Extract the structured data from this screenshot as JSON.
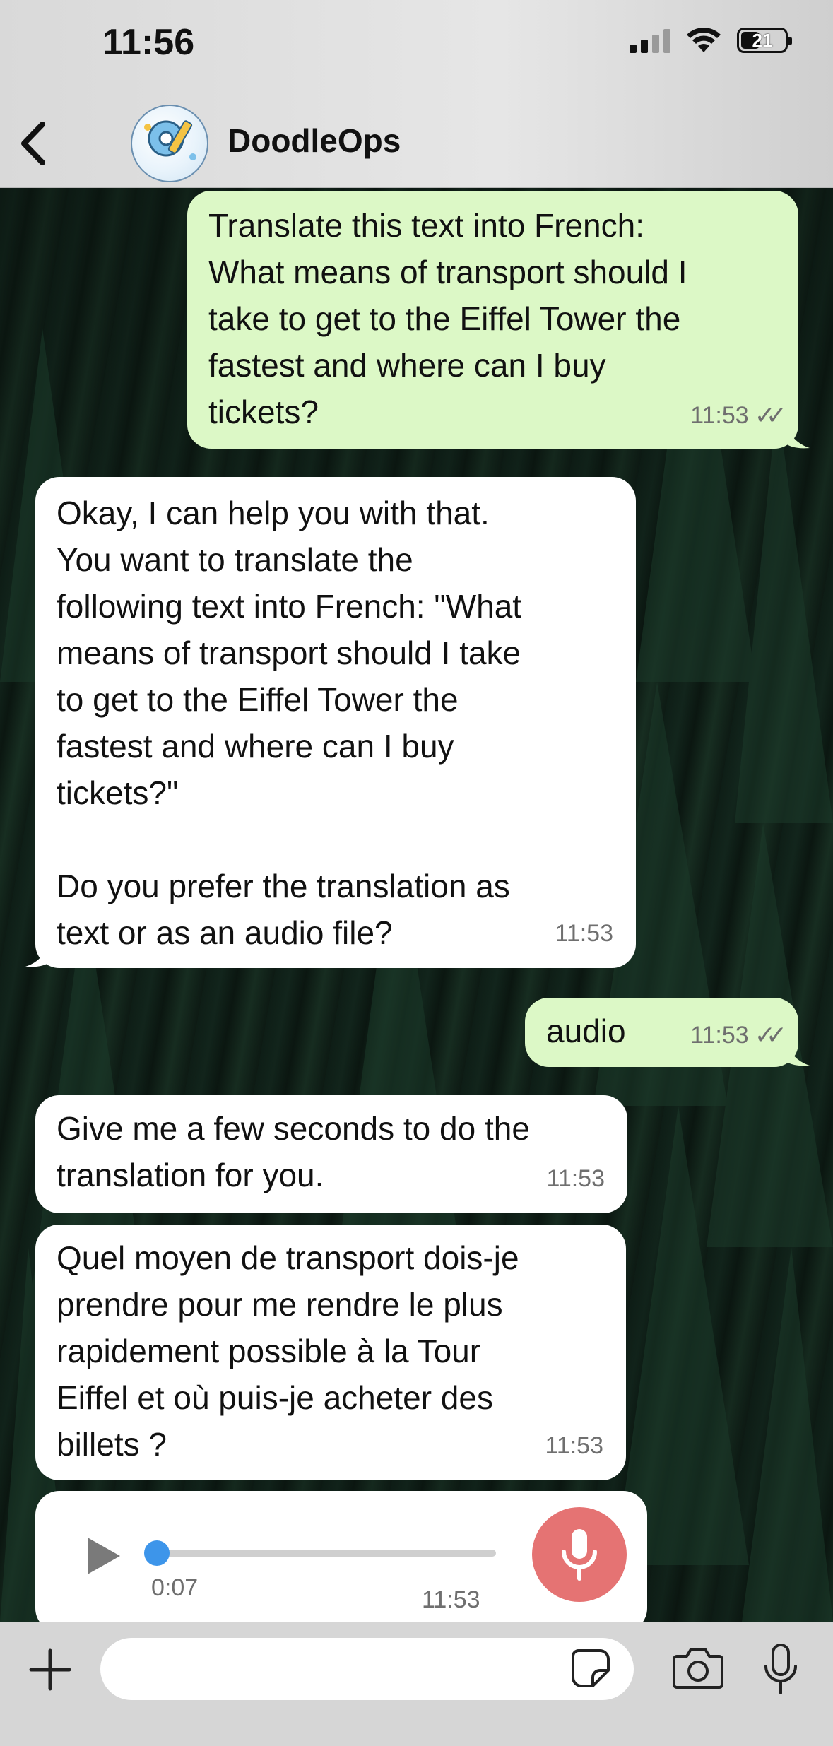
{
  "status_bar": {
    "time": "11:56",
    "battery": "21"
  },
  "header": {
    "contact_name": "DoodleOps",
    "avatar_caption": "DoodleOps"
  },
  "messages": [
    {
      "direction": "out",
      "text": "Translate this text into French:\nWhat means of transport should I\ntake to get to the Eiffel Tower the\nfastest and where can I buy\ntickets?",
      "time": "11:53",
      "status": "read"
    },
    {
      "direction": "in",
      "text": "Okay, I can help you with that.\nYou want to translate the\nfollowing text into French: \"What\nmeans of transport should I take\nto get to the Eiffel Tower the\nfastest and where can I buy\ntickets?\"\n\nDo you prefer the translation as\ntext or as an audio file?",
      "time": "11:53"
    },
    {
      "direction": "out",
      "text": "audio",
      "time": "11:53",
      "status": "read"
    },
    {
      "direction": "in",
      "text": "Give me a few seconds to do the\ntranslation for you.",
      "time": "11:53"
    },
    {
      "direction": "in",
      "text": "Quel moyen de transport dois-je\nprendre pour me rendre le plus\nrapidement possible à la Tour\nEiffel et où puis-je acheter des\nbillets ?",
      "time": "11:53"
    }
  ],
  "voice_message": {
    "duration": "0:07",
    "time": "11:53",
    "progress": 0
  },
  "composer": {
    "placeholder": ""
  },
  "colors": {
    "outgoing_bubble": "#dcf8c6",
    "incoming_bubble": "#ffffff",
    "voice_mic": "#e57373",
    "voice_knob": "#3d95ea"
  },
  "icons": [
    "back-chevron-icon",
    "signal-icon",
    "wifi-icon",
    "battery-icon",
    "play-icon",
    "microphone-icon",
    "plus-icon",
    "sticker-icon",
    "camera-icon"
  ]
}
